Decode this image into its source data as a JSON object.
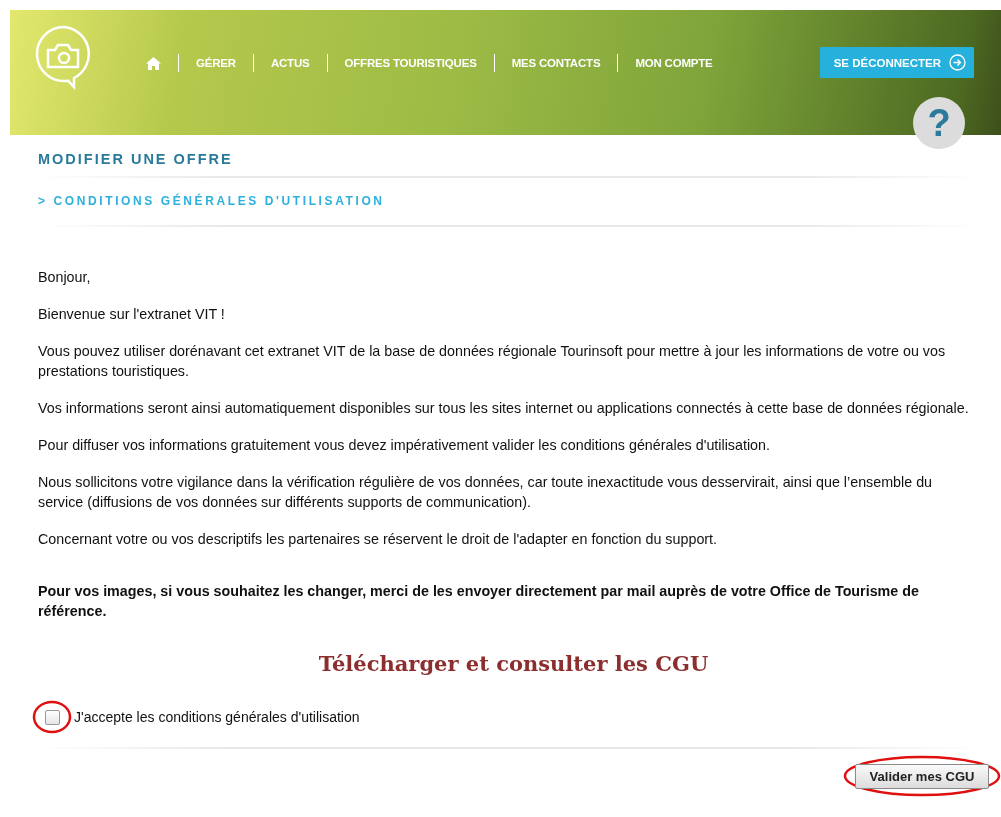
{
  "nav": {
    "items": [
      {
        "kind": "home"
      },
      {
        "kind": "text",
        "label": "GÉRER"
      },
      {
        "kind": "text",
        "label": "ACTUS"
      },
      {
        "kind": "text",
        "label": "OFFRES TOURISTIQUES"
      },
      {
        "kind": "text",
        "label": "MES CONTACTS"
      },
      {
        "kind": "text",
        "label": "MON COMPTE"
      }
    ],
    "logout": "SE DÉCONNECTER",
    "help": "?"
  },
  "page_title": "MODIFIER UNE OFFRE",
  "section_title": "> CONDITIONS GÉNÉRALES D'UTILISATION",
  "paragraphs": [
    {
      "text": "Bonjour,",
      "bold": false
    },
    {
      "text": "Bienvenue sur l'extranet VIT !",
      "bold": false
    },
    {
      "text": "Vous pouvez utiliser dorénavant cet extranet VIT de la base de données régionale Tourinsoft pour mettre à jour les informations de votre ou vos prestations touristiques.",
      "bold": false
    },
    {
      "text": "Vos informations seront ainsi automatiquement disponibles sur tous les sites internet ou applications connectés à cette base de données régionale.",
      "bold": false
    },
    {
      "text": "Pour diffuser vos informations gratuitement vous devez impérativement valider les conditions générales d'utilisation.",
      "bold": false
    },
    {
      "text": "Nous sollicitons votre vigilance dans la vérification régulière de vos données, car toute inexactitude vous desservirait, ainsi que l’ensemble du service (diffusions de vos données sur différents supports de communication).",
      "bold": false
    },
    {
      "text": "Concernant votre ou vos descriptifs les partenaires se réservent le droit de l'adapter en fonction du support.",
      "bold": false
    },
    {
      "text": "Pour vos images, si vous souhaitez les changer, merci de les envoyer directement par mail auprès de votre Office de Tourisme de référence.",
      "bold": true
    }
  ],
  "download_link": "Télécharger et consulter les CGU",
  "accept": {
    "label": "J'accepte les conditions générales d'utilisation",
    "checked": false,
    "highlighted": true
  },
  "submit": {
    "label": "Valider mes CGU",
    "highlighted": true
  }
}
